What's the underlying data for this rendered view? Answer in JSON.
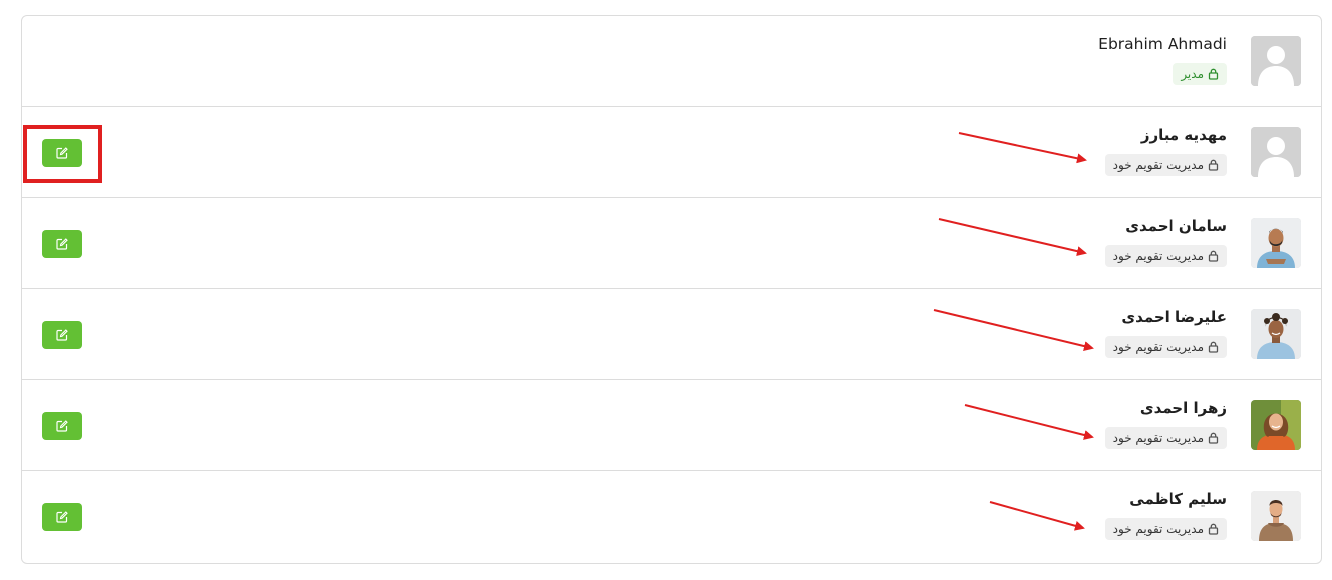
{
  "users": [
    {
      "name": "Ebrahim Ahmadi",
      "role": "مدیر",
      "is_admin": true,
      "editable": false,
      "avatar": "default-avatar-icon"
    },
    {
      "name": "مهدیه مبارز",
      "role": "مدیریت تقویم خود",
      "is_admin": false,
      "editable": true,
      "avatar": "default-avatar-icon"
    },
    {
      "name": "سامان احمدی",
      "role": "مدیریت تقویم خود",
      "is_admin": false,
      "editable": true,
      "avatar": "photo"
    },
    {
      "name": "علیرضا احمدی",
      "role": "مدیریت تقویم خود",
      "is_admin": false,
      "editable": true,
      "avatar": "photo"
    },
    {
      "name": "زهرا احمدی",
      "role": "مدیریت تقویم خود",
      "is_admin": false,
      "editable": true,
      "avatar": "photo"
    },
    {
      "name": "سلیم کاظمی",
      "role": "مدیریت تقویم خود",
      "is_admin": false,
      "editable": true,
      "avatar": "photo"
    }
  ],
  "colors": {
    "edit_button": "#63c034",
    "admin_badge_text": "#2f8f2f",
    "annotation_red": "#e02020"
  }
}
